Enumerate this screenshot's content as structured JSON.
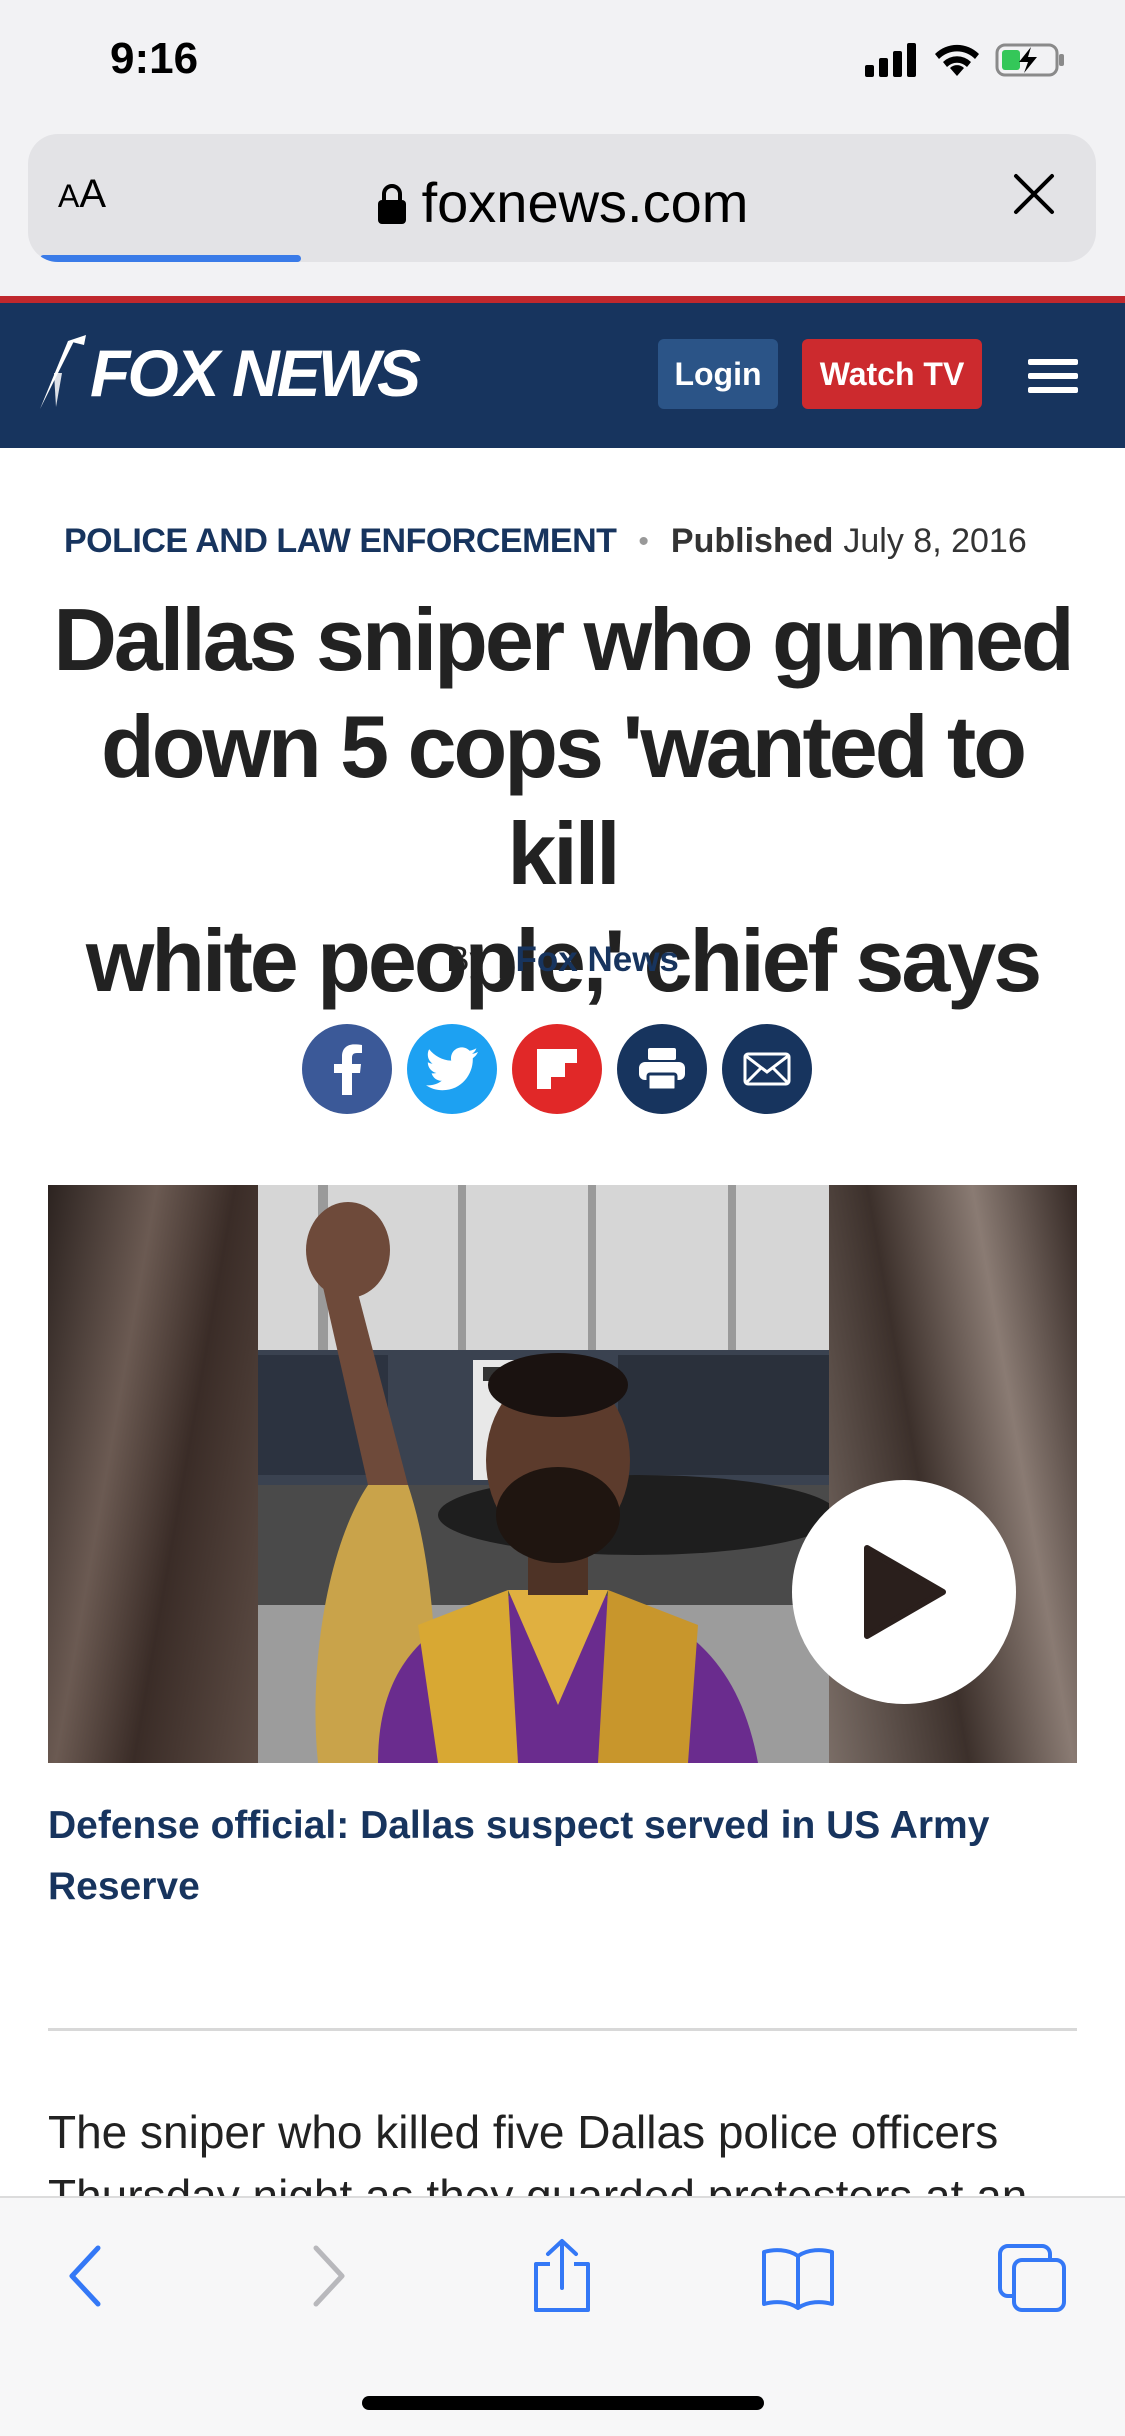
{
  "status_bar": {
    "time": "9:16"
  },
  "browser": {
    "text_size_label_small": "A",
    "text_size_label_large": "A",
    "url": "foxnews.com",
    "load_progress": 0.25
  },
  "site_header": {
    "logo_text": "FOX NEWS",
    "login_label": "Login",
    "watch_tv_label": "Watch TV"
  },
  "article": {
    "category": "POLICE AND LAW ENFORCEMENT",
    "published_label": "Published",
    "published_date": "July 8, 2016",
    "headline_line1": "Dallas sniper who gunned",
    "headline_line2": "down 5 cops 'wanted to kill",
    "headline_line3": "white people,' chief says",
    "byline_prefix": "By |",
    "byline_author": "Fox News",
    "share_icons": [
      "facebook-icon",
      "twitter-icon",
      "flipboard-icon",
      "print-icon",
      "email-icon"
    ],
    "video_caption": "Defense official: Dallas suspect served in US Army Reserve",
    "body_line1": "The sniper who killed five Dallas police officers",
    "body_line2": "Thursday night as they guarded protesters at an"
  },
  "colors": {
    "fox_navy": "#17345e",
    "fox_red": "#cc2a2e",
    "facebook": "#3b5998",
    "twitter": "#1da1f2",
    "flipboard": "#e12828",
    "progress_blue": "#3a7be8",
    "ios_blue": "#3478f6"
  },
  "toolbar": {
    "icons": [
      "back-icon",
      "forward-icon",
      "share-icon",
      "bookmarks-icon",
      "tabs-icon"
    ]
  }
}
